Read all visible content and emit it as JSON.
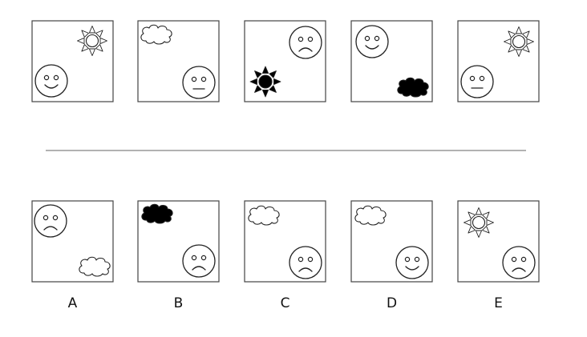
{
  "colors": {
    "stroke": "#222222",
    "box_stroke": "#444444",
    "divider": "#999999",
    "fill_dark": "#000000",
    "fill_light": "#ffffff"
  },
  "question_row": [
    {
      "face": "happy",
      "item": "sun",
      "item_fill": "light"
    },
    {
      "face": "neutral",
      "item": "cloud",
      "item_fill": "light"
    },
    {
      "face": "sad",
      "item": "sun",
      "item_fill": "dark"
    },
    {
      "face": "happy",
      "item": "cloud",
      "item_fill": "dark"
    },
    {
      "face": "neutral",
      "item": "sun",
      "item_fill": "light"
    }
  ],
  "answer_row": [
    {
      "label": "A",
      "face": "sad",
      "item": "cloud",
      "item_fill": "light"
    },
    {
      "label": "B",
      "face": "sad",
      "item": "cloud",
      "item_fill": "dark"
    },
    {
      "label": "C",
      "face": "sad",
      "item": "cloud",
      "item_fill": "light"
    },
    {
      "label": "D",
      "face": "happy",
      "item": "cloud",
      "item_fill": "light"
    },
    {
      "label": "E",
      "face": "sad",
      "item": "sun",
      "item_fill": "light"
    }
  ]
}
